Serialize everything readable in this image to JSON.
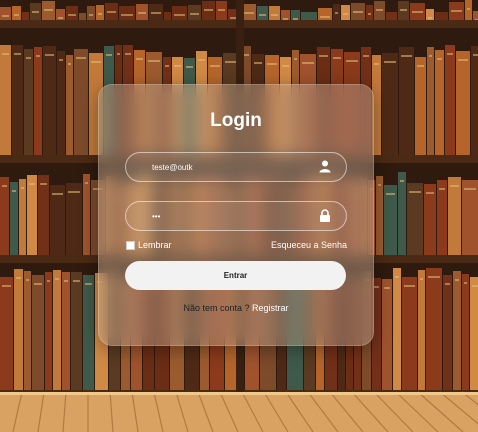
{
  "login": {
    "title": "Login",
    "email_value": "teste@outk",
    "password_value": "•••",
    "remember_label": "Lembrar",
    "forgot_label": "Esqueceu a Senha",
    "submit_label": "Entrar",
    "no_account_text": "Não tem conta ?",
    "register_label": "Registrar"
  },
  "icons": {
    "email": "user-icon",
    "password": "lock-icon"
  },
  "colors": {
    "card": "#cdb9a5",
    "button": "#f2f2f2",
    "floor": "#d9a262",
    "wood_dark": "#3a2414"
  }
}
